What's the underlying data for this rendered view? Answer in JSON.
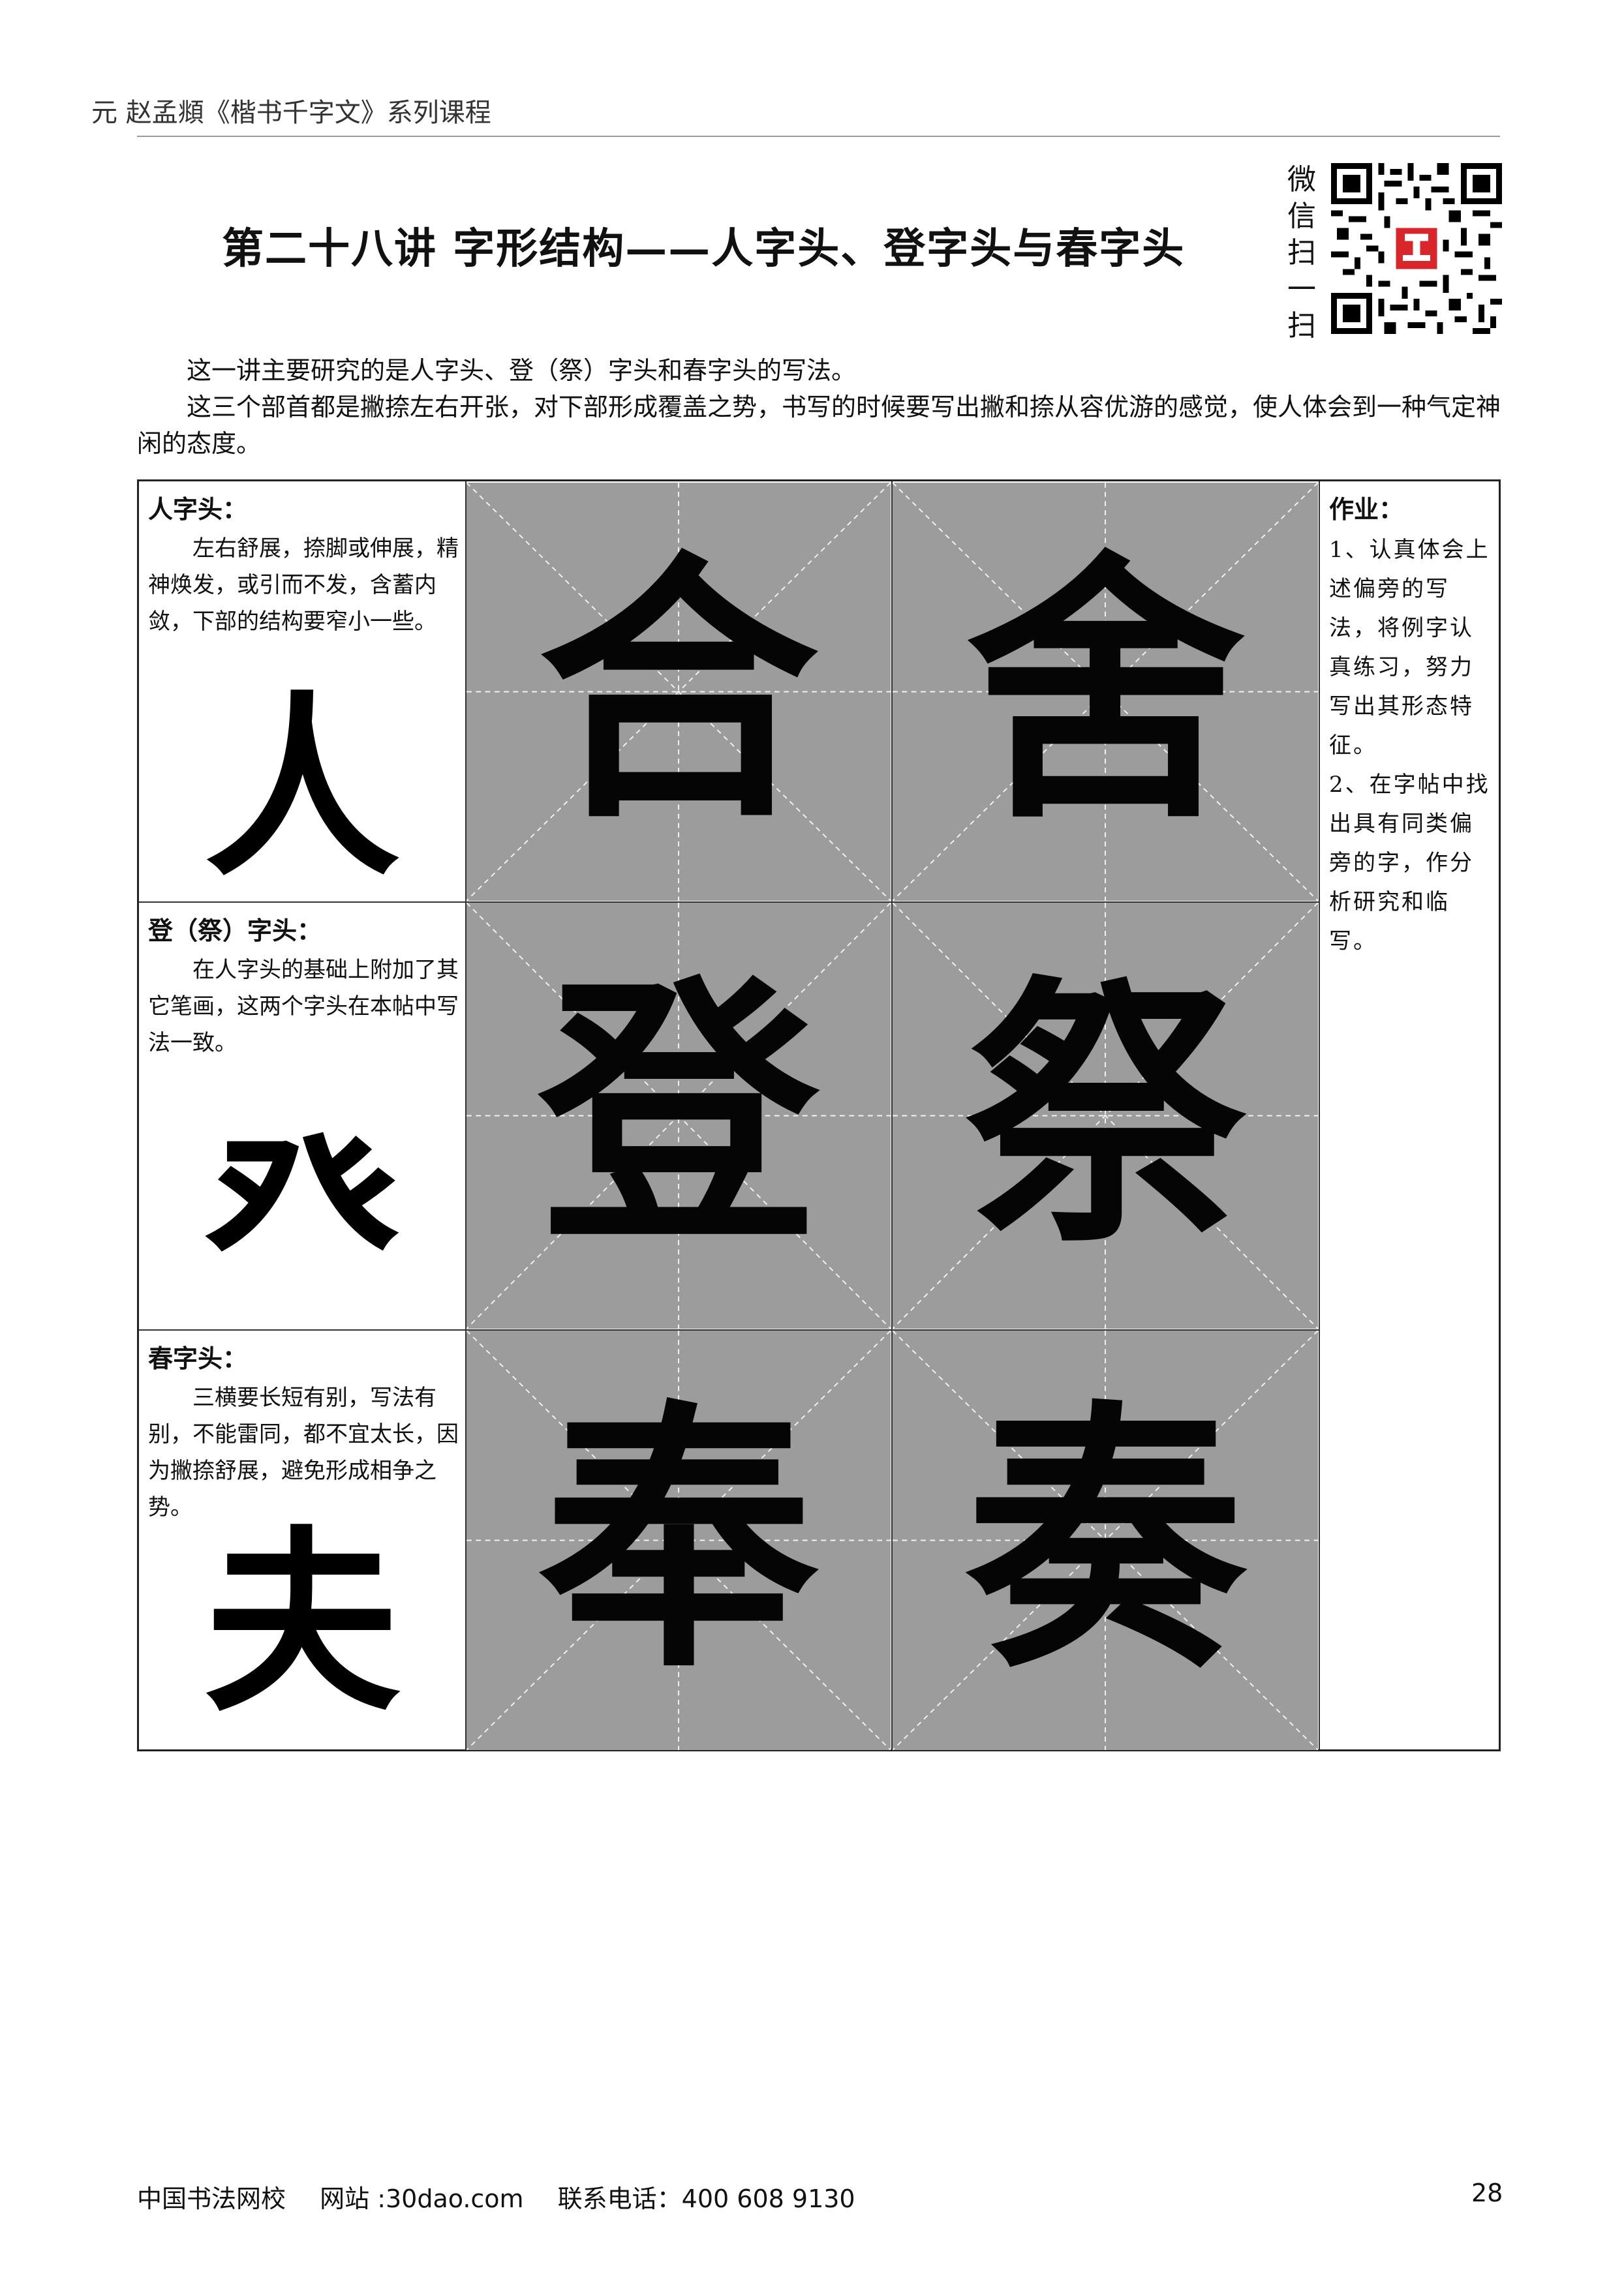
{
  "header": {
    "running_title": "元  赵孟頫《楷书千字文》系列课程"
  },
  "title": "第二十八讲  字形结构——人字头、登字头与春字头",
  "wechat": {
    "label_chars": [
      "微",
      "信",
      "扫",
      "一",
      "扫"
    ],
    "qr_icon": "qr-code-icon",
    "logo_icon": "school-logo-icon"
  },
  "intro": [
    "这一讲主要研究的是人字头、登（祭）字头和春字头的写法。",
    "这三个部首都是撇捺左右开张，对下部形成覆盖之势，书写的时候要写出撇和捺从容优游的感觉，使人体会到一种气定神闲的态度。"
  ],
  "rows": [
    {
      "heading": "人字头：",
      "description": "左右舒展，捺脚或伸展，精神焕发，或引而不发，含蓄内敛，下部的结构要窄小一些。",
      "reference_char": "人",
      "examples": [
        "合",
        "舍"
      ]
    },
    {
      "heading": "登（祭）字头：",
      "description": "在人字头的基础上附加了其它笔画，这两个字头在本帖中写法一致。",
      "reference_char": "癶",
      "examples": [
        "登",
        "祭"
      ]
    },
    {
      "heading": "春字头：",
      "description": "三横要长短有别，写法有别，不能雷同，都不宜太长，因为撇捺舒展，避免形成相争之势。",
      "reference_char": "夫",
      "examples": [
        "奉",
        "奏"
      ]
    }
  ],
  "homework": {
    "heading": "作业：",
    "items": [
      "1、认真体会上述偏旁的写法，将例字认真练习，努力写出其形态特征。",
      "2、在字帖中找出具有同类偏旁的字，作分析研究和临写。"
    ]
  },
  "footer": {
    "school": "中国书法网校",
    "website": "网站 :30dao.com",
    "phone": "联系电话：400 608 9130",
    "page_number": "28"
  },
  "colors": {
    "rubbing_bg": "#9c9c9c",
    "logo_red": "#d9262b"
  }
}
